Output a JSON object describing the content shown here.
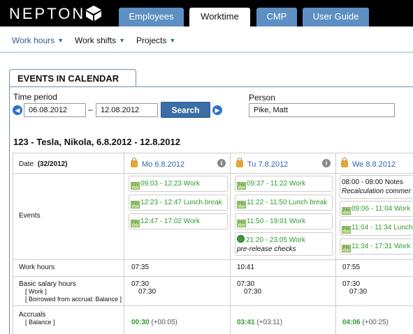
{
  "app": {
    "logo": "NEPTON"
  },
  "tabs": [
    {
      "label": "Employees",
      "active": false
    },
    {
      "label": "Worktime",
      "active": true
    },
    {
      "label": "CMP",
      "active": false
    },
    {
      "label": "User Guide",
      "active": false
    }
  ],
  "subnav": [
    {
      "label": "Work hours",
      "active": true
    },
    {
      "label": "Work shifts",
      "active": false
    },
    {
      "label": "Projects",
      "active": false
    }
  ],
  "panel": {
    "title": "EVENTS IN CALENDAR",
    "time_period_label": "Time period",
    "date_from": "06.08.2012",
    "date_to": "12.08.2012",
    "dash": "–",
    "search_label": "Search",
    "person_label": "Person",
    "person_value": "Pike, Matt"
  },
  "subtitle": "123 - Tesla, Nikola, 6.8.2012 - 12.8.2012",
  "grid": {
    "date_label": "Date",
    "week": "(32/2012)",
    "row_labels": {
      "events": "Events",
      "work_hours": "Work hours",
      "basic_salary": "Basic salary hours",
      "basic_work": "[ Work ]",
      "basic_borrowed": "[ Borrowed from accrual: Balance ]",
      "accruals": "Accruals",
      "accruals_balance": "[ Balance ]"
    },
    "days": [
      {
        "head": "Mo 6.8.2012",
        "events": [
          {
            "badge": "PIN",
            "text": "09:03 - 12:23 Work"
          },
          {
            "badge": "PIN",
            "text": "12:23 - 12:47 Lunch break"
          },
          {
            "badge": "PIN",
            "text": "12:47 - 17:02 Work"
          }
        ],
        "work_hours": "07:35",
        "basic_salary": "07:30",
        "basic_work": "07:30",
        "accrual": "00:30",
        "accrual_delta": "(+00:05)"
      },
      {
        "head": "Tu 7.8.2012",
        "events": [
          {
            "badge": "PIN",
            "text": "09:37 - 11:22 Work"
          },
          {
            "badge": "PIN",
            "text": "11:22 - 11:50 Lunch break"
          },
          {
            "badge": "PIN",
            "text": "11:50 - 19:01 Work"
          },
          {
            "badge": "globe",
            "text": "21:20 - 23:05 Work",
            "note": "pre-release checks"
          }
        ],
        "work_hours": "10:41",
        "basic_salary": "07:30",
        "basic_work": "07:30",
        "accrual": "03:41",
        "accrual_delta": "(+03:11)"
      },
      {
        "head": "We 8.8.2012",
        "events": [
          {
            "badge": "",
            "text": "08:00 - 08:00 Notes",
            "note": "Recalculation commer"
          },
          {
            "badge": "PIN",
            "text": "09:06 - 11:04 Work"
          },
          {
            "badge": "PIN",
            "text": "11:04 - 11:34 Lunch"
          },
          {
            "badge": "PIN",
            "text": "11:34 - 17:31 Work"
          }
        ],
        "work_hours": "07:55",
        "basic_salary": "07:30",
        "basic_work": "07:30",
        "accrual": "04:06",
        "accrual_delta": "(+00:25)"
      }
    ]
  },
  "icons": {
    "logo_mark": "cube-logo-icon",
    "prev": "prev-arrow-icon",
    "next": "next-arrow-icon",
    "lock": "lock-icon",
    "info": "info-icon",
    "pin": "pin-badge-icon",
    "globe": "globe-icon"
  },
  "colors": {
    "tab_blue": "#5d8fc2",
    "search_blue": "#3a6ea5",
    "event_green": "#2f9a2f",
    "link_blue": "#2f5fb4"
  }
}
